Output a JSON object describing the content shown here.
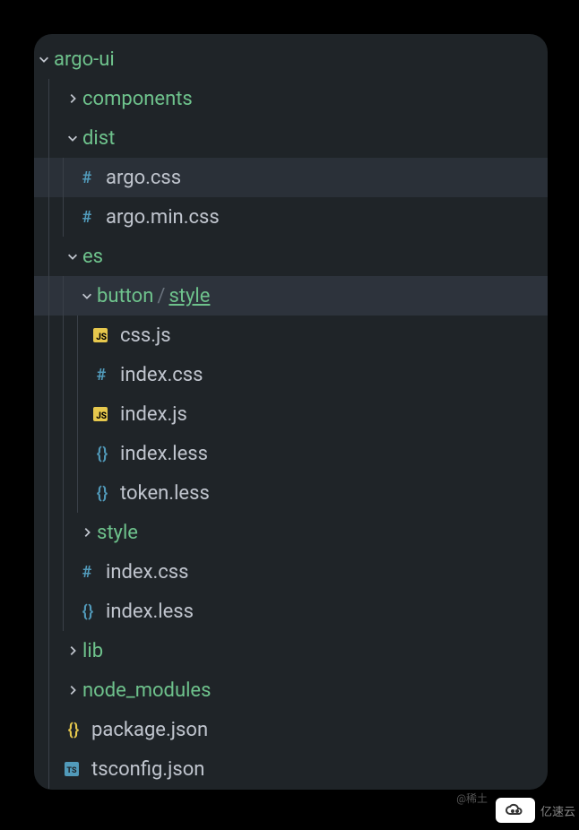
{
  "root": {
    "name": "argo-ui"
  },
  "items": {
    "components": "components",
    "dist": "dist",
    "argo_css": "argo.css",
    "argo_min_css": "argo.min.css",
    "es": "es",
    "button": "button",
    "style": "style",
    "css_js": "css.js",
    "index_css": "index.css",
    "index_js": "index.js",
    "index_less": "index.less",
    "token_less": "token.less",
    "style_folder": "style",
    "es_index_css": "index.css",
    "es_index_less": "index.less",
    "lib": "lib",
    "node_modules": "node_modules",
    "package_json": "package.json",
    "tsconfig_json": "tsconfig.json"
  },
  "watermark": {
    "at": "@稀土",
    "brand": "亿速云"
  }
}
